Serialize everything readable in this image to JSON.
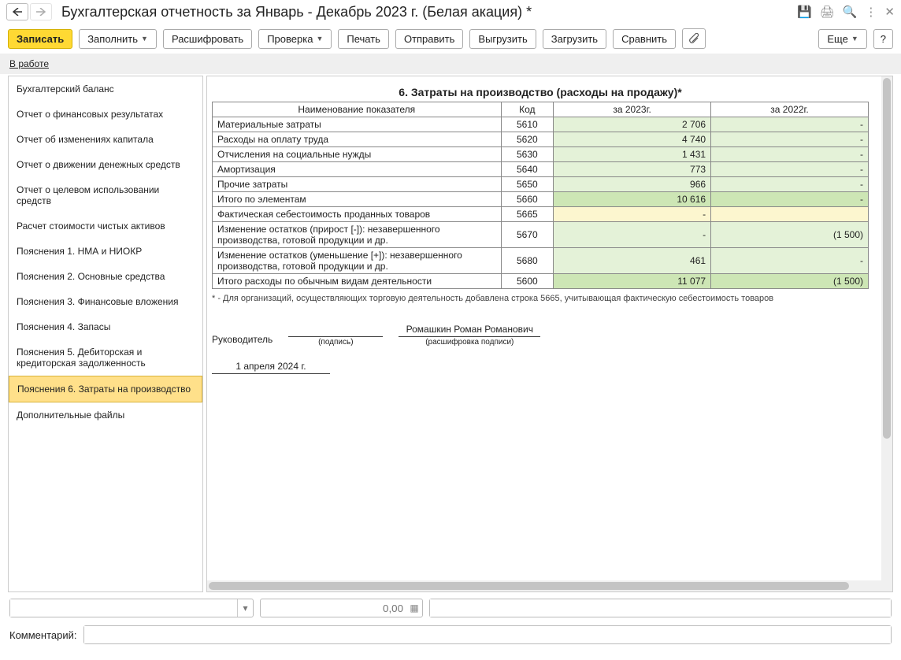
{
  "title": "Бухгалтерская отчетность за Январь - Декабрь 2023 г. (Белая акация) *",
  "toolbar": {
    "write": "Записать",
    "fill": "Заполнить",
    "decode": "Расшифровать",
    "check": "Проверка",
    "print": "Печать",
    "send": "Отправить",
    "unload": "Выгрузить",
    "load": "Загрузить",
    "compare": "Сравнить",
    "more": "Еще",
    "help": "?"
  },
  "status": {
    "label": "В работе"
  },
  "sidebar": {
    "items": [
      "Бухгалтерский баланс",
      "Отчет о финансовых результатах",
      "Отчет об изменениях капитала",
      "Отчет о движении денежных средств",
      "Отчет о целевом использовании средств",
      "Расчет стоимости чистых активов",
      "Пояснения 1. НМА и НИОКР",
      "Пояснения 2. Основные средства",
      "Пояснения 3. Финансовые вложения",
      "Пояснения 4. Запасы",
      "Пояснения 5. Дебиторская и кредиторская задолженность",
      "Пояснения 6. Затраты на производство",
      "Дополнительные файлы"
    ],
    "activeIndex": 11
  },
  "report": {
    "heading": "6. Затраты на производство (расходы на продажу)*",
    "columns": {
      "name": "Наименование показателя",
      "code": "Код",
      "y1": "за 2023г.",
      "y2": "за 2022г."
    },
    "rows": [
      {
        "name": "Материальные затраты",
        "code": "5610",
        "y1": "2 706",
        "y2": "-",
        "cls": "greenish"
      },
      {
        "name": "Расходы на оплату труда",
        "code": "5620",
        "y1": "4 740",
        "y2": "-",
        "cls": "greenish"
      },
      {
        "name": "Отчисления на социальные нужды",
        "code": "5630",
        "y1": "1 431",
        "y2": "-",
        "cls": "greenish"
      },
      {
        "name": "Амортизация",
        "code": "5640",
        "y1": "773",
        "y2": "-",
        "cls": "greenish"
      },
      {
        "name": "Прочие затраты",
        "code": "5650",
        "y1": "966",
        "y2": "-",
        "cls": "greenish"
      },
      {
        "name": "Итого по элементам",
        "code": "5660",
        "y1": "10 616",
        "y2": "-",
        "cls": "green-strong"
      },
      {
        "name": "Фактическая себестоимость проданных товаров",
        "code": "5665",
        "y1": "-",
        "y2": "",
        "cls": "yellowish"
      },
      {
        "name": "Изменение остатков (прирост [-]): незавершенного производства, готовой продукции и др.",
        "code": "5670",
        "y1": "-",
        "y2": "(1 500)",
        "cls": "greenish"
      },
      {
        "name": "Изменение остатков (уменьшение [+]): незавершенного производства, готовой продукции и др.",
        "code": "5680",
        "y1": "461",
        "y2": "-",
        "cls": "greenish"
      },
      {
        "name": "Итого расходы по обычным видам деятельности",
        "code": "5600",
        "y1": "11 077",
        "y2": "(1 500)",
        "cls": "green-strong"
      }
    ],
    "footnote": "* - Для организаций, осуществляющих торговую деятельность добавлена строка 5665, учитывающая фактическую себестоимость товаров"
  },
  "signature": {
    "role": "Руководитель",
    "sign_hint": "(подпись)",
    "name": "Ромашкин Роман Романович",
    "name_hint": "(расшифровка подписи)",
    "date": "1 апреля 2024 г."
  },
  "bottom": {
    "num_placeholder": "0,00",
    "comment_label": "Комментарий:"
  }
}
